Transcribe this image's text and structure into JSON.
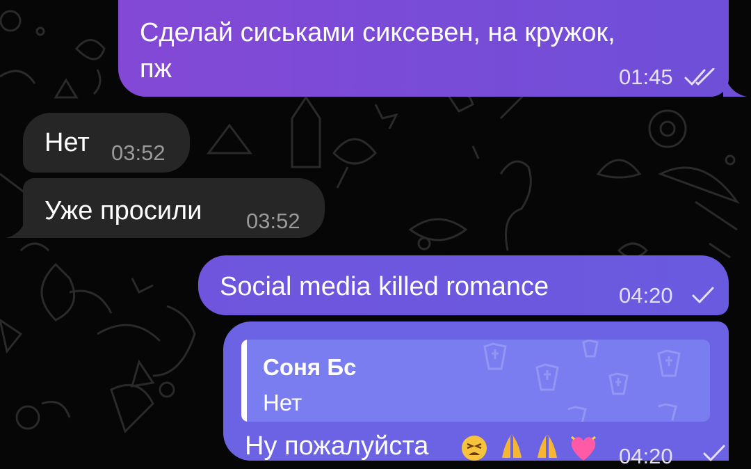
{
  "messages": [
    {
      "direction": "outgoing",
      "text_line1": "Сделай сиськами сиксевен, на кружок,",
      "text_line2": "пж",
      "time": "01:45",
      "status": "read-double-check-icon"
    },
    {
      "direction": "incoming",
      "text": "Нет",
      "time": "03:52"
    },
    {
      "direction": "incoming",
      "text": "Уже просили",
      "time": "03:52"
    },
    {
      "direction": "outgoing",
      "text": "Social media killed romance",
      "time": "04:20",
      "status": "sent-check-icon"
    },
    {
      "direction": "outgoing",
      "reply": {
        "author": "Соня Бс",
        "text": "Нет"
      },
      "text": "Ну пожалуйста",
      "emoji": [
        "tired-face-emoji",
        "folded-hands-emoji",
        "folded-hands-emoji",
        "heart-emoji"
      ],
      "time": "04:20",
      "status": "sent-check-icon"
    }
  ],
  "colors": {
    "background": "#060606",
    "outgoing_bubble": "#7a4fd8",
    "incoming_bubble": "#262626",
    "reply_box": "#7a7df0"
  }
}
